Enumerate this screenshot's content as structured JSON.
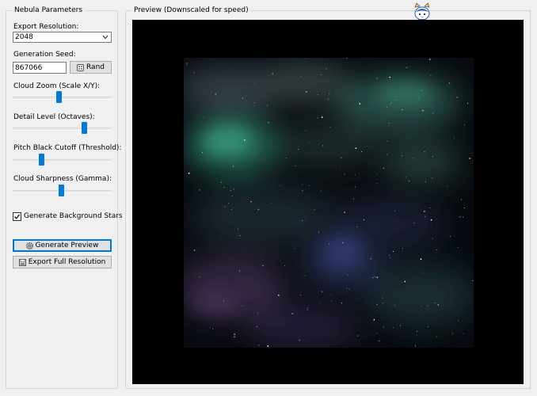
{
  "params": {
    "group_title": "Nebula Parameters",
    "export_resolution_label": "Export Resolution:",
    "export_resolution_value": "2048",
    "seed_label": "Generation Seed:",
    "seed_value": "867066",
    "rand_label": "Rand",
    "cloud_zoom_label": "Cloud Zoom (Scale X/Y):",
    "cloud_zoom_level": 0.46,
    "detail_label": "Detail Level (Octaves):",
    "detail_level": 0.72,
    "threshold_label": "Pitch Black Cutoff (Threshold):",
    "threshold_level": 0.29,
    "gamma_label": "Cloud Sharpness (Gamma):",
    "gamma_level": 0.49,
    "stars_label": "Generate Background Stars",
    "stars_checked": true,
    "generate_preview_label": "Generate Preview",
    "export_full_label": "Export Full Resolution"
  },
  "preview": {
    "group_title": "Preview (Downscaled for speed)"
  },
  "colors": {
    "accent": "#0078d7",
    "slider_thumb": "#007ad9",
    "nebula_teal": "#3a8a74",
    "nebula_purple": "#4a3a6a",
    "preview_bg": "#000000"
  },
  "icons": [
    "chevron-down-icon",
    "dice-icon",
    "gear-icon",
    "save-icon",
    "checkmark-icon",
    "mascot-icon"
  ]
}
